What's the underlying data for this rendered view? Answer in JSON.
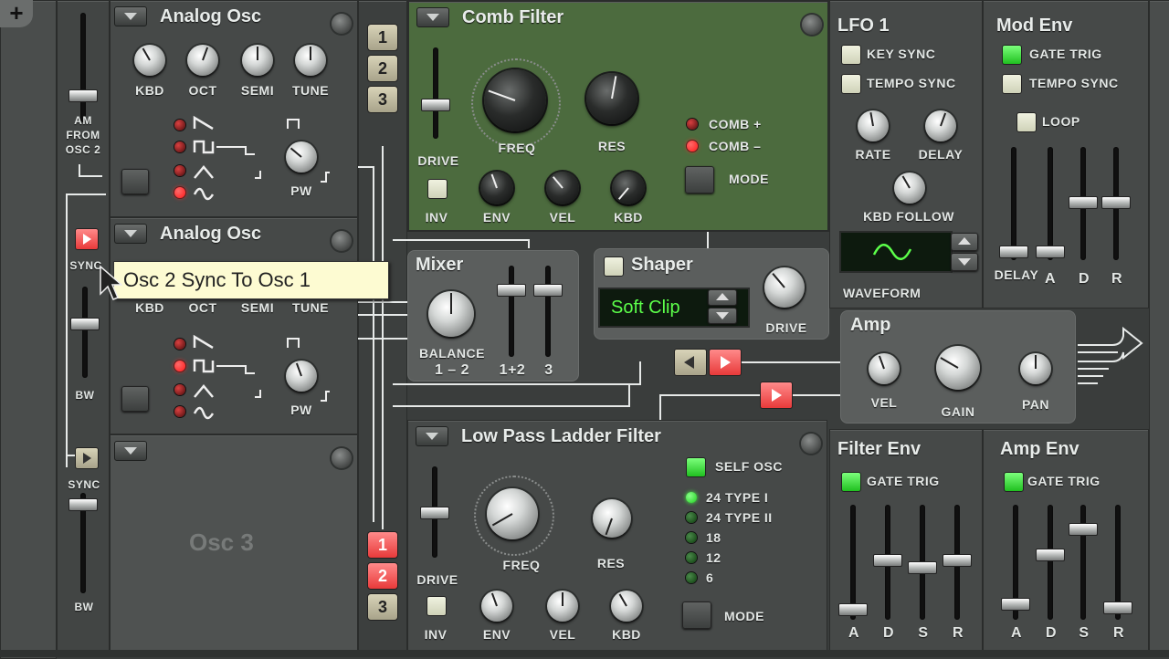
{
  "osc1": {
    "title": "Analog Osc",
    "knobs": [
      "KBD",
      "OCT",
      "SEMI",
      "TUNE"
    ],
    "pw": "PW",
    "am_label": "AM\nFROM\nOSC 2"
  },
  "osc2": {
    "title": "Analog Osc",
    "knobs": [
      "KBD",
      "OCT",
      "SEMI",
      "TUNE"
    ],
    "pw": "PW",
    "sync": "SYNC",
    "bw": "BW"
  },
  "osc3": {
    "title": "Osc 3",
    "sync": "SYNC",
    "bw": "BW"
  },
  "tooltip": "Osc 2 Sync To Osc 1",
  "comb": {
    "title": "Comb Filter",
    "freq": "FREQ",
    "res": "RES",
    "drive": "DRIVE",
    "inv": "INV",
    "env": "ENV",
    "vel": "VEL",
    "kbd": "KBD",
    "comb_plus": "COMB +",
    "comb_minus": "COMB –",
    "mode": "MODE",
    "routes": [
      "1",
      "2",
      "3"
    ]
  },
  "mixer": {
    "title": "Mixer",
    "balance": "BALANCE",
    "balance_sub": "1 – 2",
    "ch12": "1+2",
    "ch3": "3"
  },
  "shaper": {
    "title": "Shaper",
    "value": "Soft Clip",
    "drive": "DRIVE"
  },
  "lpf": {
    "title": "Low Pass Ladder Filter",
    "freq": "FREQ",
    "res": "RES",
    "drive": "DRIVE",
    "inv": "INV",
    "env": "ENV",
    "vel": "VEL",
    "kbd": "KBD",
    "self_osc": "SELF OSC",
    "types": [
      "24 TYPE I",
      "24 TYPE II",
      "18",
      "12",
      "6"
    ],
    "mode": "MODE",
    "routes": [
      "1",
      "2",
      "3"
    ]
  },
  "lfo1": {
    "title": "LFO 1",
    "key_sync": "KEY SYNC",
    "tempo_sync": "TEMPO SYNC",
    "rate": "RATE",
    "delay": "DELAY",
    "kbd_follow": "KBD FOLLOW",
    "waveform": "WAVEFORM"
  },
  "modenv": {
    "title": "Mod Env",
    "gate_trig": "GATE TRIG",
    "tempo_sync": "TEMPO SYNC",
    "loop": "LOOP",
    "sliders": [
      "DELAY",
      "A",
      "D",
      "R"
    ]
  },
  "amp": {
    "title": "Amp",
    "vel": "VEL",
    "gain": "GAIN",
    "pan": "PAN"
  },
  "filterenv": {
    "title": "Filter Env",
    "gate_trig": "GATE TRIG",
    "sliders": [
      "A",
      "D",
      "S",
      "R"
    ]
  },
  "ampenv": {
    "title": "Amp Env",
    "gate_trig": "GATE TRIG",
    "sliders": [
      "A",
      "D",
      "S",
      "R"
    ]
  },
  "colors": {
    "panel": "#464948",
    "comb_green": "#4c6b3e",
    "lcd_text": "#5cff4a",
    "led_red": "#ff1a1a",
    "led_green": "#20d020"
  }
}
